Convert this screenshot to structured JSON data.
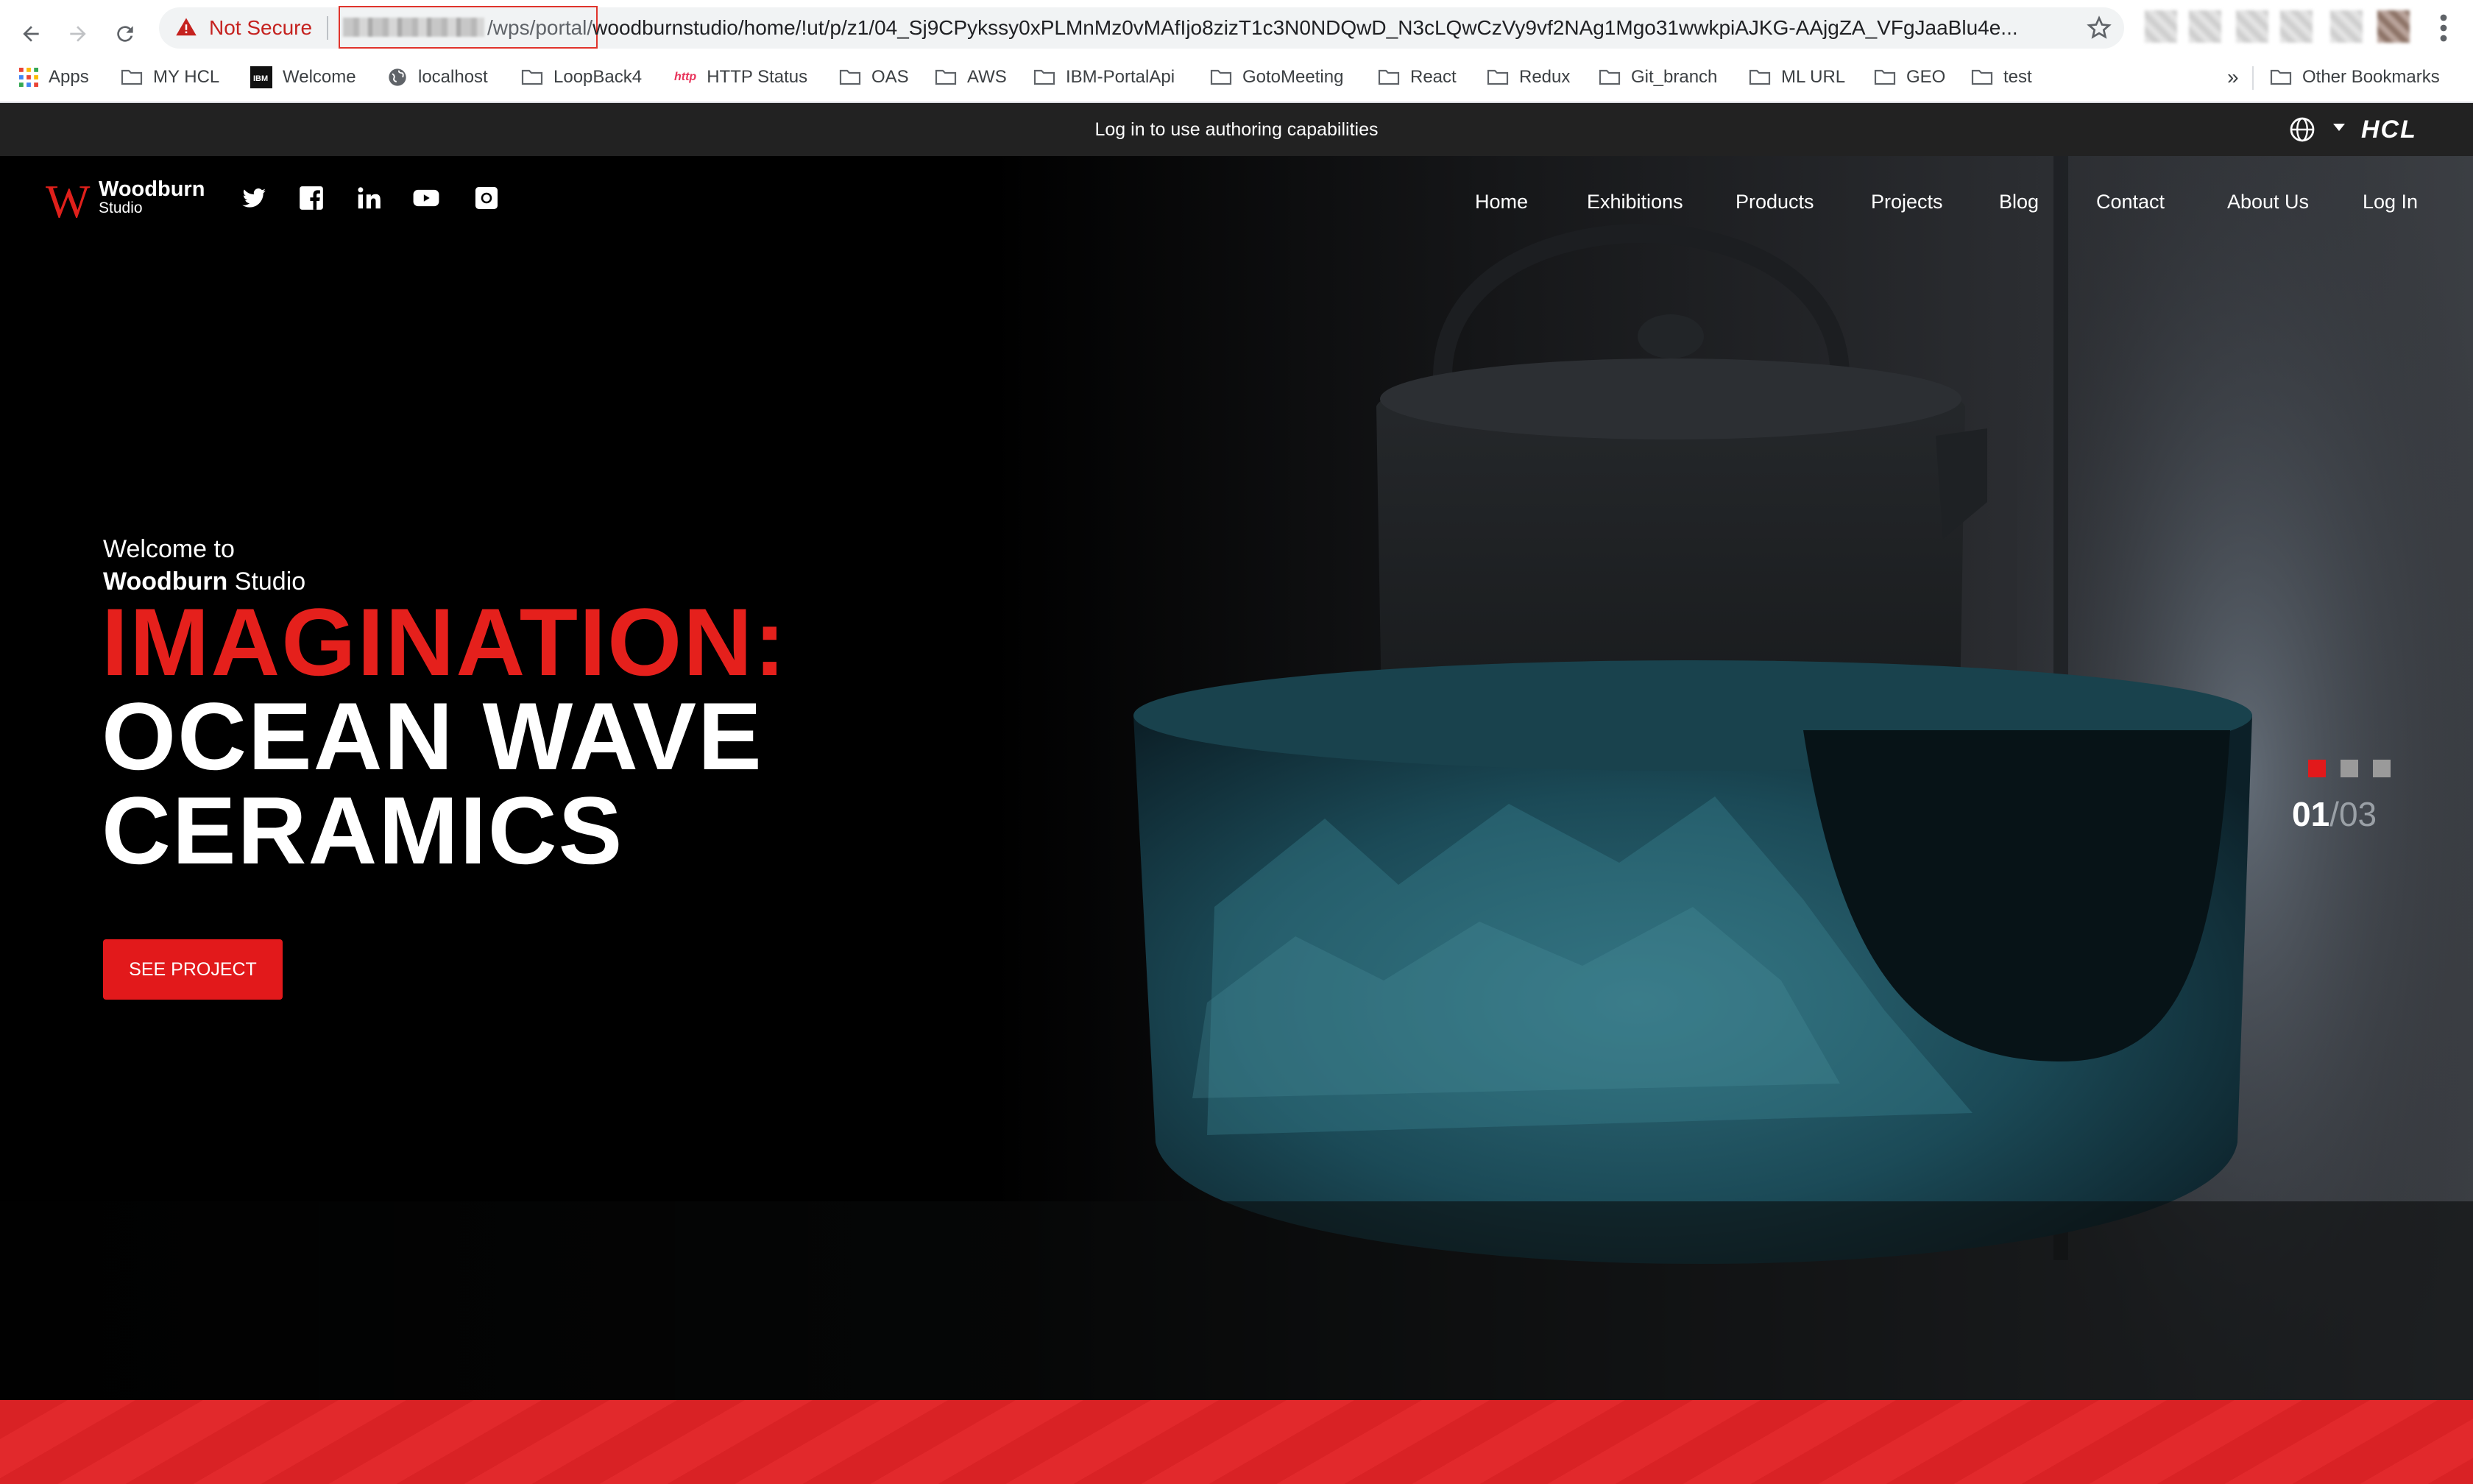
{
  "browser": {
    "security_label": "Not Secure",
    "url_path": "/wps/portal/",
    "url_rest": "woodburnstudio/home/!ut/p/z1/04_Sj9CPykssy0xPLMnMz0vMAfIjo8zizT1c3N0NDQwD_N3cLQwCzVy9vf2NAg1Mgo31wwkpiAJKG-AAjgZA_VFgJaaBlu4e...",
    "bookmarks": [
      {
        "label": "Apps",
        "icon": "apps-grid-icon"
      },
      {
        "label": "MY HCL",
        "icon": "folder-icon"
      },
      {
        "label": "Welcome",
        "icon": "ibm-icon"
      },
      {
        "label": "localhost",
        "icon": "globe-icon"
      },
      {
        "label": "LoopBack4",
        "icon": "folder-icon"
      },
      {
        "label": "HTTP Status",
        "icon": "http-icon"
      },
      {
        "label": "OAS",
        "icon": "folder-icon"
      },
      {
        "label": "AWS",
        "icon": "folder-icon"
      },
      {
        "label": "IBM-PortalApi",
        "icon": "folder-icon"
      },
      {
        "label": "GotoMeeting",
        "icon": "folder-icon"
      },
      {
        "label": "React",
        "icon": "folder-icon"
      },
      {
        "label": "Redux",
        "icon": "folder-icon"
      },
      {
        "label": "Git_branch",
        "icon": "folder-icon"
      },
      {
        "label": "ML URL",
        "icon": "folder-icon"
      },
      {
        "label": "GEO",
        "icon": "folder-icon"
      },
      {
        "label": "test",
        "icon": "folder-icon"
      }
    ],
    "overflow_label": "»",
    "other_bookmarks": "Other Bookmarks"
  },
  "authoring_bar": {
    "message": "Log in to use authoring capabilities",
    "brand": "HCL"
  },
  "site": {
    "logo_mark": "W",
    "logo_name": "Woodburn",
    "logo_sub": "Studio",
    "social": [
      "twitter-icon",
      "facebook-icon",
      "linkedin-icon",
      "youtube-icon",
      "instagram-icon"
    ],
    "nav": [
      "Home",
      "Exhibitions",
      "Products",
      "Projects",
      "Blog",
      "Contact",
      "About Us",
      "Log In"
    ]
  },
  "hero": {
    "welcome": "Welcome to",
    "studio_bold": "Woodburn",
    "studio_rest": " Studio",
    "headline_red": "IMAGINATION:",
    "headline_line2": "OCEAN WAVE",
    "headline_line3": "CERAMICS",
    "cta": "SEE PROJECT",
    "slide_current": "01",
    "slide_separator": "/",
    "slide_total": "03",
    "active_slide": 1
  },
  "colors": {
    "brand_red": "#e5201c",
    "auth_bar": "#222222",
    "not_secure": "#c5221f"
  }
}
